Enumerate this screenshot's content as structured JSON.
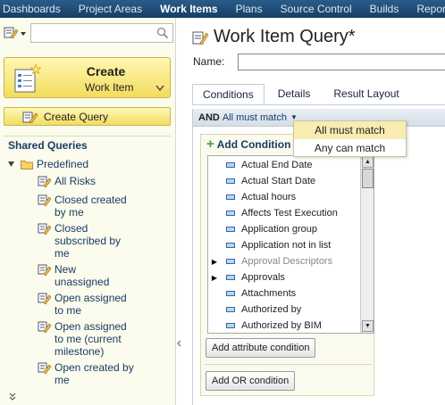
{
  "nav": {
    "items": [
      {
        "label": "Dashboards",
        "active": false
      },
      {
        "label": "Project Areas",
        "active": false
      },
      {
        "label": "Work Items",
        "active": true
      },
      {
        "label": "Plans",
        "active": false
      },
      {
        "label": "Source Control",
        "active": false
      },
      {
        "label": "Builds",
        "active": false
      },
      {
        "label": "Reports",
        "active": false
      }
    ]
  },
  "sidebar": {
    "search": {
      "value": "",
      "placeholder": ""
    },
    "create": {
      "title": "Create",
      "subtitle": "Work Item"
    },
    "create_query": {
      "label_strong": "Create",
      "label_rest": " Query"
    },
    "shared_queries_title": "Shared Queries",
    "tree_root": "Predefined",
    "queries": [
      {
        "label": "All Risks"
      },
      {
        "label": "Closed created by me"
      },
      {
        "label": "Closed subscribed by me"
      },
      {
        "label": "New unassigned"
      },
      {
        "label": "Open assigned to me"
      },
      {
        "label": "Open assigned to me (current milestone)"
      },
      {
        "label": "Open created by me"
      }
    ]
  },
  "main": {
    "title": "Work Item Query*",
    "name_label": "Name:",
    "name_value": "",
    "tabs": [
      {
        "label": "Conditions",
        "active": true
      },
      {
        "label": "Details",
        "active": false
      },
      {
        "label": "Result Layout",
        "active": false
      }
    ],
    "and_bar": {
      "operator": "AND",
      "mode": "All must match"
    },
    "add_condition_label": "Add Condition",
    "attributes": [
      {
        "label": "Actual End Date",
        "expandable": false,
        "disabled": false
      },
      {
        "label": "Actual Start Date",
        "expandable": false,
        "disabled": false
      },
      {
        "label": "Actual hours",
        "expandable": false,
        "disabled": false
      },
      {
        "label": "Affects Test Execution",
        "expandable": false,
        "disabled": false
      },
      {
        "label": "Application group",
        "expandable": false,
        "disabled": false
      },
      {
        "label": "Application not in list",
        "expandable": false,
        "disabled": false
      },
      {
        "label": "Approval Descriptors",
        "expandable": true,
        "disabled": true
      },
      {
        "label": "Approvals",
        "expandable": true,
        "disabled": false
      },
      {
        "label": "Attachments",
        "expandable": false,
        "disabled": false
      },
      {
        "label": "Authorized by",
        "expandable": false,
        "disabled": false
      },
      {
        "label": "Authorized by BIM",
        "expandable": false,
        "disabled": false
      }
    ],
    "add_attribute_button": "Add attribute condition",
    "add_or_button": "Add OR condition"
  },
  "dropdown": {
    "options": [
      {
        "label": "All must match",
        "selected": true
      },
      {
        "label": "Any can match",
        "selected": false
      }
    ]
  }
}
